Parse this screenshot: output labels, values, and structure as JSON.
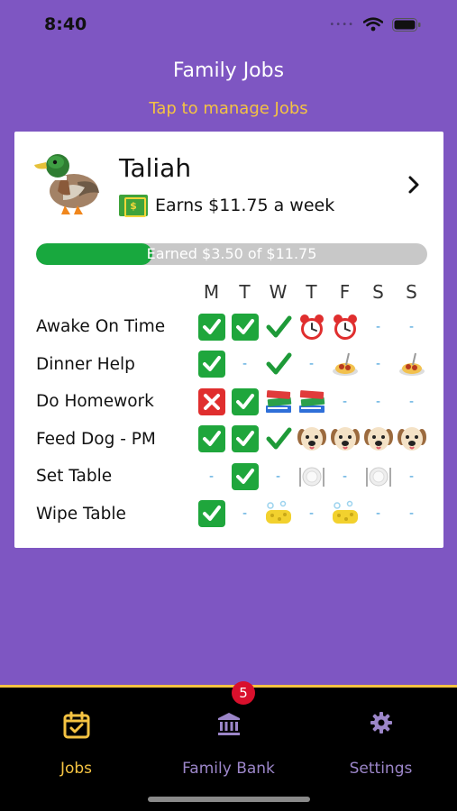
{
  "status_bar": {
    "time": "8:40"
  },
  "header": {
    "title": "Family Jobs",
    "manage_link": "Tap to manage Jobs"
  },
  "kid": {
    "name": "Taliah",
    "earns_text": "Earns $11.75 a week",
    "progress_text": "Earned $3.50 of $11.75",
    "progress_fraction": 0.298
  },
  "days": [
    "M",
    "T",
    "W",
    "T",
    "F",
    "S",
    "S"
  ],
  "jobs": [
    {
      "name": "Awake On Time",
      "cells": [
        "check",
        "check",
        "tick",
        "clock",
        "clock",
        "dash",
        "dash"
      ]
    },
    {
      "name": "Dinner Help",
      "cells": [
        "check",
        "dash",
        "tick",
        "dash",
        "spaghetti",
        "dash",
        "spaghetti"
      ]
    },
    {
      "name": "Do Homework",
      "cells": [
        "cross",
        "check",
        "books",
        "books",
        "dash",
        "dash",
        "dash"
      ]
    },
    {
      "name": "Feed Dog - PM",
      "cells": [
        "check",
        "check",
        "tick",
        "dog",
        "dog",
        "dog",
        "dog"
      ]
    },
    {
      "name": "Set Table",
      "cells": [
        "dash",
        "check",
        "dash",
        "plate",
        "dash",
        "plate",
        "dash"
      ]
    },
    {
      "name": "Wipe Table",
      "cells": [
        "check",
        "dash",
        "sponge",
        "dash",
        "sponge",
        "dash",
        "dash"
      ]
    }
  ],
  "dash_text": "-",
  "tabs": [
    {
      "label": "Jobs",
      "icon": "calendar-check-icon",
      "active": true
    },
    {
      "label": "Family Bank",
      "icon": "bank-icon",
      "active": false
    },
    {
      "label": "Settings",
      "icon": "gear-icon",
      "active": false
    }
  ],
  "badge_count": "5",
  "colors": {
    "background": "#7E56C2",
    "accent": "#F5C342",
    "progress": "#18A83E",
    "tab_inactive": "#9C86C9"
  }
}
